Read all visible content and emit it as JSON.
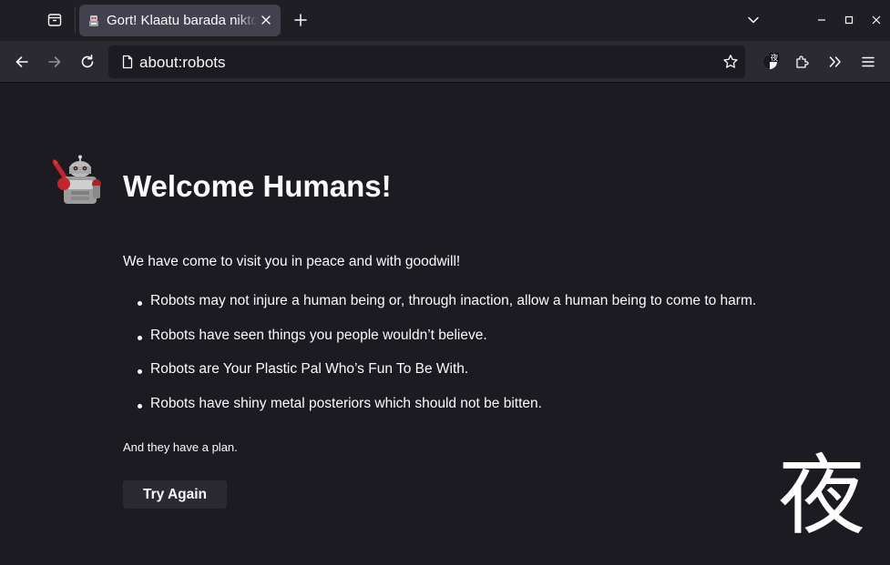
{
  "browser": {
    "tab": {
      "title": "Gort! Klaatu barada nikto!",
      "favicon": "robot-icon"
    },
    "url": "about:robots",
    "colors": {
      "background": "#1c1b22",
      "tabstrip": "#1f1e25",
      "toolbar": "#2b2a33",
      "selected_tab": "#42414d",
      "text": "#fbfbfe"
    },
    "icons": [
      "tab-list-icon",
      "close-icon",
      "plus-icon",
      "chevron-down-icon",
      "minimize-icon",
      "maximize-icon",
      "window-close-icon",
      "back-icon",
      "forward-icon",
      "reload-icon",
      "page-icon",
      "star-icon",
      "dark-mode-extension-icon",
      "extensions-icon",
      "overflow-chevron-icon",
      "hamburger-menu-icon"
    ]
  },
  "page": {
    "title": "Welcome Humans!",
    "intro": "We have come to visit you in peace and with goodwill!",
    "laws": [
      "Robots may not injure a human being or, through inaction, allow a human being to come to harm.",
      "Robots have seen things you people wouldn’t believe.",
      "Robots are Your Plastic Pal Who’s Fun To Be With.",
      "Robots have shiny metal posteriors which should not be bitten."
    ],
    "plan": "And they have a plan.",
    "try_again_label": "Try Again"
  },
  "overlay": {
    "night_glyph": "夜",
    "extension_badge": "夜"
  }
}
